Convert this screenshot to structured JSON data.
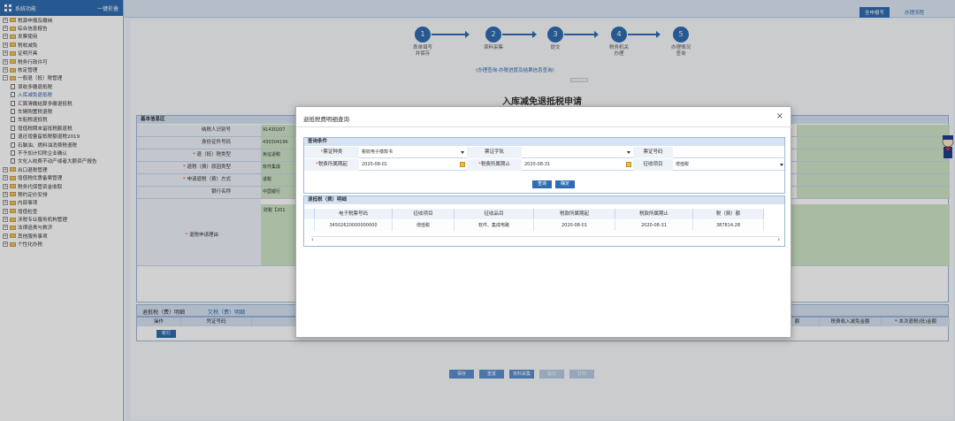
{
  "sidebar": {
    "title": "系统功能",
    "action": "一键折叠",
    "items": [
      {
        "label": "税源申报及缴纳",
        "level": 0,
        "sign": "+"
      },
      {
        "label": "综合信息报告",
        "level": 0,
        "sign": "+"
      },
      {
        "label": "发票使用",
        "level": 0,
        "sign": "+"
      },
      {
        "label": "税收减免",
        "level": 0,
        "sign": "+"
      },
      {
        "label": "证明开具",
        "level": 0,
        "sign": "+"
      },
      {
        "label": "税务行政许可",
        "level": 0,
        "sign": "+"
      },
      {
        "label": "核定管理",
        "level": 0,
        "sign": "+"
      },
      {
        "label": "一般退（抵）税管理",
        "level": 0,
        "sign": "−"
      },
      {
        "label": "误收多缴退抵税",
        "level": 1
      },
      {
        "label": "入库减免退抵税",
        "level": 1,
        "active": true
      },
      {
        "label": "汇算清缴结算多缴退抵税",
        "level": 1
      },
      {
        "label": "车辆购置税退税",
        "level": 1
      },
      {
        "label": "车船税退抵税",
        "level": 1
      },
      {
        "label": "增值税期末留抵税额退税",
        "level": 1
      },
      {
        "label": "退还增量留抵税额退税2019",
        "level": 1
      },
      {
        "label": "石脑油、燃料油消费税退税",
        "level": 1
      },
      {
        "label": "不予加计扣除企业确认",
        "level": 1
      },
      {
        "label": "文化入收费不动产或者大额资产报告",
        "level": 1
      },
      {
        "label": "出口退税管理",
        "level": 0,
        "sign": "+"
      },
      {
        "label": "增值税优惠备案管理",
        "level": 0,
        "sign": "+"
      },
      {
        "label": "税务代保管资金收取",
        "level": 0,
        "sign": "+"
      },
      {
        "label": "预约定价安排",
        "level": 0,
        "sign": "+"
      },
      {
        "label": "内部事项",
        "level": 0,
        "sign": "+"
      },
      {
        "label": "增值检查",
        "level": 0,
        "sign": "+"
      },
      {
        "label": "涉税专业服务机构管理",
        "level": 0,
        "sign": "+"
      },
      {
        "label": "法律追责与救济",
        "level": 0,
        "sign": "+"
      },
      {
        "label": "其他服务事项",
        "level": 0,
        "sign": "+"
      },
      {
        "label": "个性化办税",
        "level": 0,
        "sign": "+"
      }
    ]
  },
  "topbar": {
    "tabs": [
      "全申报写",
      "办理流程"
    ]
  },
  "steps": [
    {
      "num": "1",
      "label": "表单填写\n并保存"
    },
    {
      "num": "2",
      "label": "资料采集"
    },
    {
      "num": "3",
      "label": "提交"
    },
    {
      "num": "4",
      "label": "税务机关\n办理"
    },
    {
      "num": "5",
      "label": "办理情况\n查询"
    }
  ],
  "step_link": "(办理查询-办税进度及结果信息查询)",
  "page_title": "入库减免退抵税申请",
  "form": {
    "section": "基本信息区",
    "rows": [
      {
        "key": "纳税人识别号",
        "value": "91430207",
        "required": false
      },
      {
        "key": "身份证件号码",
        "value": "430304196",
        "required": false
      },
      {
        "key": "退（抵）税类型",
        "value": "免征退税",
        "required": true
      },
      {
        "key": "退税（费）原因类型",
        "value": "软件集成",
        "required": true
      },
      {
        "key": "申请退税（费）方式",
        "value": "退税",
        "required": true
      },
      {
        "key": "银行名称",
        "value": "中国银行",
        "required": false
      },
      {
        "key": "银行账号",
        "value": "",
        "required": false
      }
    ],
    "reason_key": "退税申请理由",
    "reason_value": "财税【201"
  },
  "bottom_tabs": {
    "a": "退抵税（费）明细",
    "b": "欠税（费）明细"
  },
  "bottom_grid": {
    "headers": [
      "操作",
      "凭证号码"
    ],
    "add": "新行",
    "right_headers": [
      "额",
      "税费收入减免金额",
      "* 本次退税(抵)金额"
    ]
  },
  "page_buttons": [
    {
      "label": "保存",
      "disabled": false
    },
    {
      "label": "重置",
      "disabled": false
    },
    {
      "label": "资料采集",
      "disabled": false
    },
    {
      "label": "提交",
      "disabled": true
    },
    {
      "label": "打印",
      "disabled": true
    }
  ],
  "modal": {
    "title": "退抵税费明细查询",
    "close": "×",
    "query_section": "查询条件",
    "q": {
      "voucher_type_label": "票证种类",
      "voucher_type": "税收电子缴款书",
      "voucher_no_label": "票证字轨",
      "voucher_no": "",
      "voucher_num_label": "票证号码",
      "voucher_num": "",
      "start_label": "税费所属期起",
      "start": "2020-08-01",
      "end_label": "税费所属期止",
      "end": "2020-08-31",
      "item_label": "征收项目",
      "item": "增值税"
    },
    "query_btn": "查询",
    "reset_btn": "确定",
    "detail_section": "退抵税（费）明细",
    "columns": [
      "电子税票号码",
      "征收项目",
      "征收品目",
      "税款所属期起",
      "税款所属期止",
      "税（费）额"
    ],
    "rows": [
      [
        "34502620000000000",
        "增值税",
        "软件、集成电路",
        "2020-08-01",
        "2020-08-31",
        "387814.28"
      ]
    ]
  }
}
